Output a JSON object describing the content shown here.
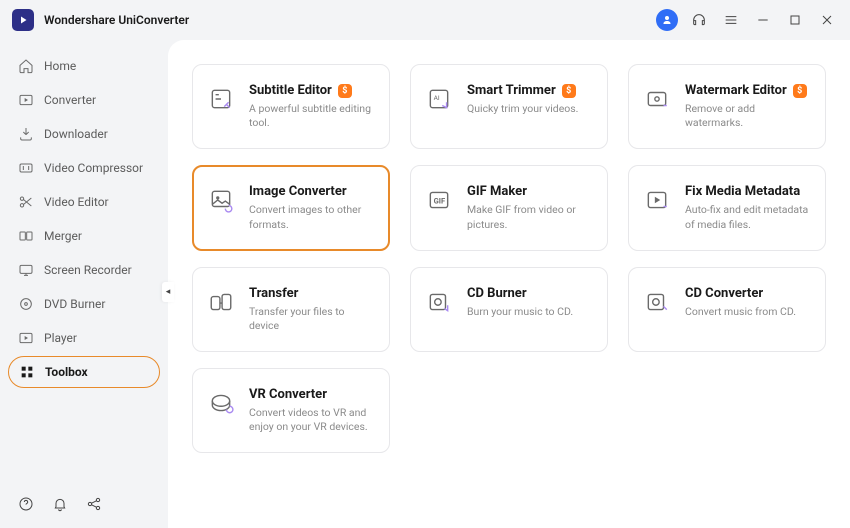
{
  "app": {
    "title": "Wondershare UniConverter"
  },
  "sidebar": {
    "items": [
      {
        "label": "Home"
      },
      {
        "label": "Converter"
      },
      {
        "label": "Downloader"
      },
      {
        "label": "Video Compressor"
      },
      {
        "label": "Video Editor"
      },
      {
        "label": "Merger"
      },
      {
        "label": "Screen Recorder"
      },
      {
        "label": "DVD Burner"
      },
      {
        "label": "Player"
      },
      {
        "label": "Toolbox"
      }
    ],
    "active_index": 9
  },
  "tools": [
    {
      "title": "Subtitle Editor",
      "desc": "A powerful subtitle editing tool.",
      "badge": "$"
    },
    {
      "title": "Smart Trimmer",
      "desc": "Quicky trim your videos.",
      "badge": "$"
    },
    {
      "title": "Watermark Editor",
      "desc": "Remove or add watermarks.",
      "badge": "$"
    },
    {
      "title": "Image Converter",
      "desc": "Convert images to other formats.",
      "badge": null,
      "selected": true
    },
    {
      "title": "GIF Maker",
      "desc": "Make GIF from video or pictures.",
      "badge": null
    },
    {
      "title": "Fix Media Metadata",
      "desc": "Auto-fix and edit metadata of media files.",
      "badge": null
    },
    {
      "title": "Transfer",
      "desc": "Transfer your files to device",
      "badge": null
    },
    {
      "title": "CD Burner",
      "desc": "Burn your music to CD.",
      "badge": null
    },
    {
      "title": "CD Converter",
      "desc": "Convert music from CD.",
      "badge": null
    },
    {
      "title": "VR Converter",
      "desc": "Convert videos to VR and enjoy on your VR devices.",
      "badge": null
    }
  ],
  "badge_char": "$"
}
